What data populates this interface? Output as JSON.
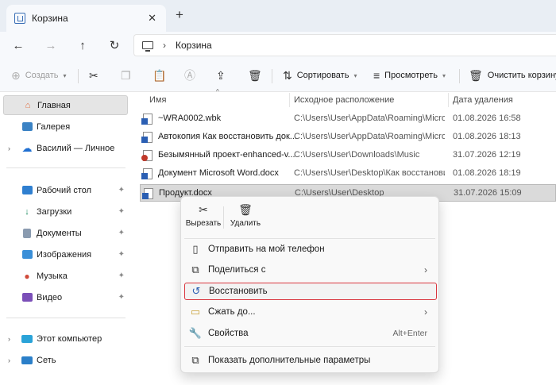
{
  "window": {
    "tab_title": "Корзина",
    "tab_close": "✕",
    "new_tab": "+"
  },
  "nav": {
    "back": "←",
    "forward": "→",
    "up": "↑",
    "refresh": "↻",
    "breadcrumb": "Корзина",
    "crumb_sep": "›"
  },
  "commandbar": {
    "create": "Создать",
    "sort": "Сортировать",
    "view": "Просмотреть",
    "empty_bin": "Очистить корзину"
  },
  "sidebar": {
    "items": [
      {
        "label": "Главная",
        "icon": "home-icon"
      },
      {
        "label": "Галерея",
        "icon": "gallery-icon"
      },
      {
        "label": "Василий — Личное",
        "icon": "cloud-icon"
      },
      {
        "label": "Рабочий стол",
        "icon": "desktop-icon"
      },
      {
        "label": "Загрузки",
        "icon": "download-icon"
      },
      {
        "label": "Документы",
        "icon": "documents-icon"
      },
      {
        "label": "Изображения",
        "icon": "pictures-icon"
      },
      {
        "label": "Музыка",
        "icon": "music-icon"
      },
      {
        "label": "Видео",
        "icon": "video-icon"
      },
      {
        "label": "Этот компьютер",
        "icon": "computer-icon"
      },
      {
        "label": "Сеть",
        "icon": "network-icon"
      }
    ]
  },
  "columns": {
    "name": "Имя",
    "location": "Исходное расположение",
    "deleted": "Дата удаления"
  },
  "files": [
    {
      "name": "~WRA0002.wbk",
      "location": "C:\\Users\\User\\AppData\\Roaming\\Micros...",
      "date": "01.08.2026 16:58"
    },
    {
      "name": "Автокопия Как восстановить док...",
      "location": "C:\\Users\\User\\AppData\\Roaming\\Micros...",
      "date": "01.08.2026 18:13"
    },
    {
      "name": "Безымянный проект-enhanced-v...",
      "location": "C:\\Users\\User\\Downloads\\Music",
      "date": "31.07.2026 12:19"
    },
    {
      "name": "Документ Microsoft Word.docx",
      "location": "C:\\Users\\User\\Desktop\\Как восстановит...",
      "date": "01.08.2026 18:19"
    },
    {
      "name": "Продукт.docx",
      "location": "C:\\Users\\User\\Desktop",
      "date": "31.07.2026 15:09"
    }
  ],
  "context_menu": {
    "cut": "Вырезать",
    "delete": "Удалить",
    "send_to_phone": "Отправить на мой телефон",
    "share": "Поделиться с",
    "restore": "Восстановить",
    "compress": "Сжать до...",
    "properties": "Свойства",
    "properties_shortcut": "Alt+Enter",
    "more_options": "Показать дополнительные параметры"
  },
  "colors": {
    "highlight_border": "#d9363e",
    "selection": "#dadada",
    "accent": "#2b5fb3"
  }
}
